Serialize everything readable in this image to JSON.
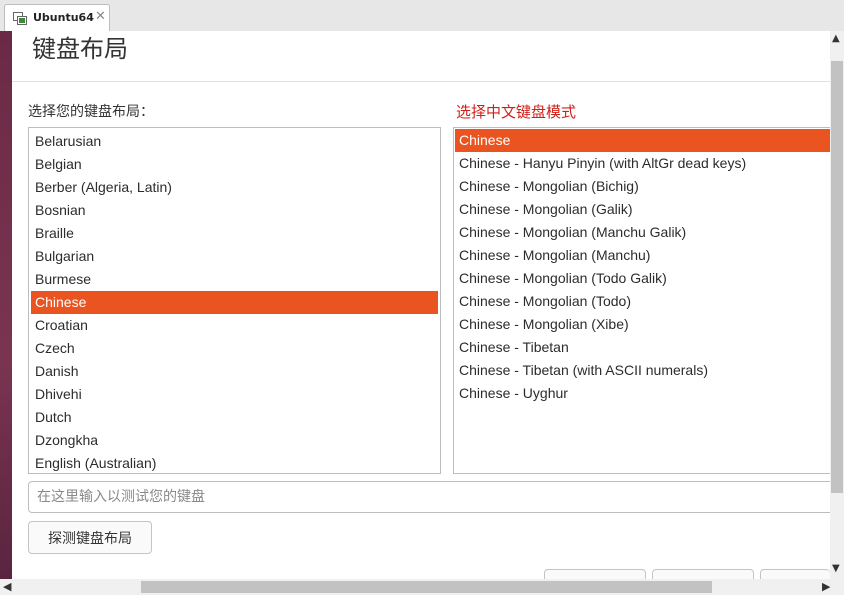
{
  "tab": {
    "label": "Ubuntu64",
    "close_glyph": "✕",
    "icon": "vm-icon"
  },
  "page": {
    "title": "键盘布局"
  },
  "left_list": {
    "heading": "选择您的键盘布局：",
    "items": [
      "Belarusian",
      "Belgian",
      "Berber (Algeria, Latin)",
      "Bosnian",
      "Braille",
      "Bulgarian",
      "Burmese",
      "Chinese",
      "Croatian",
      "Czech",
      "Danish",
      "Dhivehi",
      "Dutch",
      "Dzongkha",
      "English (Australian)"
    ],
    "selected": "Chinese"
  },
  "right_list": {
    "heading": "选择中文键盘模式",
    "heading_color": "#d0201a",
    "items": [
      "Chinese",
      "Chinese - Hanyu Pinyin (with AltGr dead keys)",
      "Chinese - Mongolian (Bichig)",
      "Chinese - Mongolian (Galik)",
      "Chinese - Mongolian (Manchu Galik)",
      "Chinese - Mongolian (Manchu)",
      "Chinese - Mongolian (Todo Galik)",
      "Chinese - Mongolian (Todo)",
      "Chinese - Mongolian (Xibe)",
      "Chinese - Tibetan",
      "Chinese - Tibetan (with ASCII numerals)",
      "Chinese - Uyghur"
    ],
    "selected": "Chinese"
  },
  "test_input": {
    "placeholder": "在这里输入以测试您的键盘",
    "value": ""
  },
  "detect_button": {
    "label": "探测键盘布局"
  },
  "colors": {
    "selection": "#e95420"
  },
  "scrollbars": {
    "up": "▲",
    "down": "▼",
    "left": "◀",
    "right": "▶"
  }
}
